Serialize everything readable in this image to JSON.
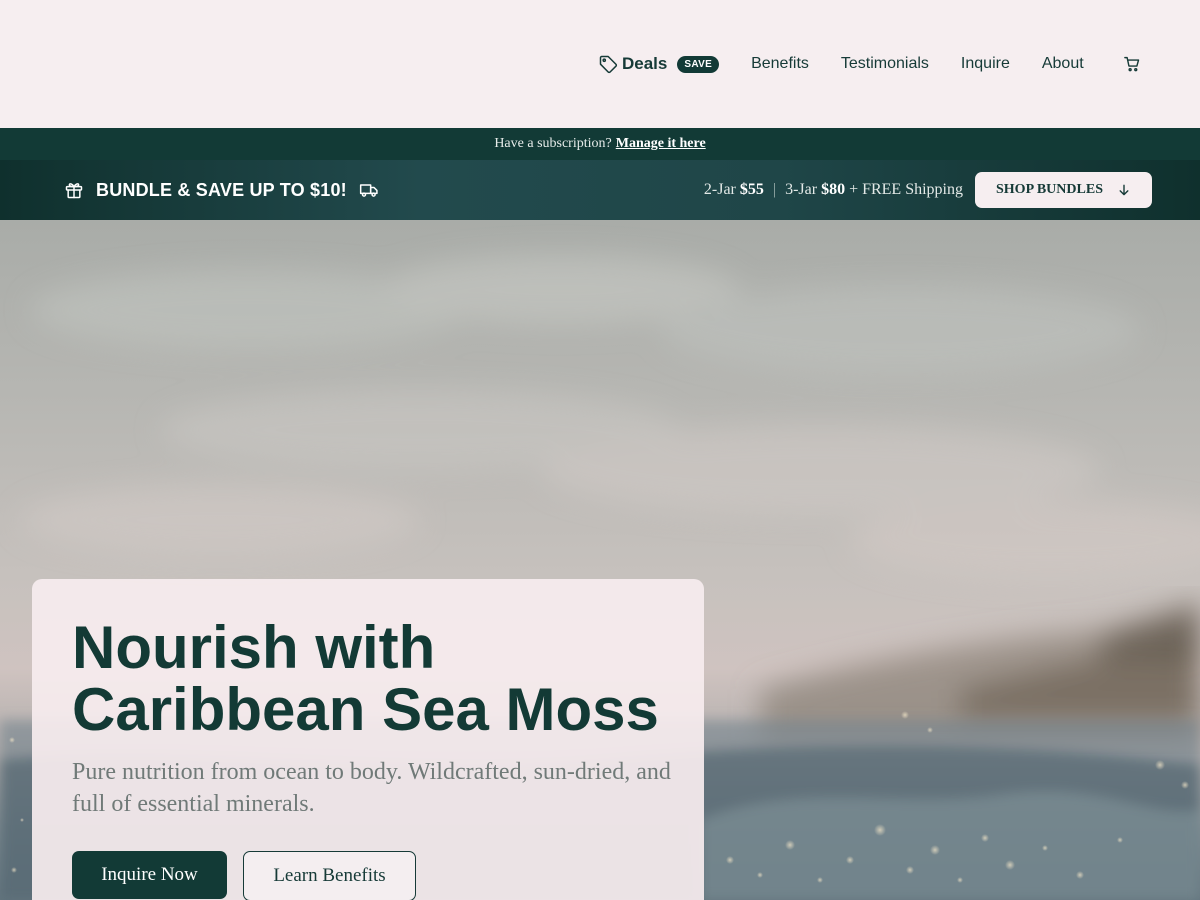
{
  "header": {
    "nav": {
      "deals_label": "Deals",
      "deals_badge": "SAVE",
      "benefits_label": "Benefits",
      "testimonials_label": "Testimonials",
      "inquire_label": "Inquire",
      "about_label": "About"
    },
    "icons": {
      "deals": "tag-icon",
      "cart": "cart-icon"
    }
  },
  "subscription_bar": {
    "text": "Have a subscription?",
    "link_label": "Manage it here"
  },
  "bundle_bar": {
    "title": "BUNDLE & SAVE UP TO $10!",
    "offer_1_label": "2-Jar",
    "offer_1_price": "$55",
    "separator": "|",
    "offer_2_label": "3-Jar",
    "offer_2_price": "$80",
    "shipping_text": "+ FREE Shipping",
    "cta_label": "SHOP BUNDLES",
    "icons": {
      "left": "gift-icon",
      "right": "truck-icon",
      "cta": "arrow-down-icon"
    }
  },
  "hero": {
    "title_line_1": "Nourish with",
    "title_line_2": "Caribbean Sea Moss",
    "subtitle": "Pure nutrition from ocean to body. Wildcrafted, sun-dried, and full of essential minerals.",
    "primary_cta": "Inquire Now",
    "secondary_cta": "Learn Benefits"
  },
  "colors": {
    "brand_dark_green": "#123a36",
    "header_background": "#f6eef0",
    "subtitle_gray": "#707a78"
  }
}
